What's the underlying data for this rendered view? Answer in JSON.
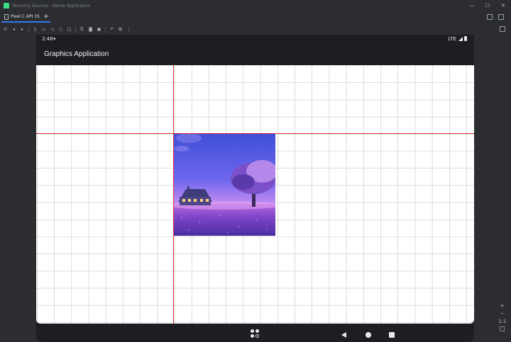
{
  "window": {
    "title": "Running Devices - Demo Application",
    "controls": [
      "—",
      "☐",
      "✕"
    ]
  },
  "tabs": [
    {
      "label": "Pixel C API 35",
      "close": "×"
    }
  ],
  "tab_add": "+",
  "toolbar": {
    "icons": [
      "power-icon",
      "volume-down-icon",
      "volume-up-icon",
      "rotate-left-icon",
      "rotate-right-icon",
      "back-icon",
      "home-icon",
      "overview-icon",
      "screenshot-icon",
      "camera-icon",
      "record-icon",
      "undo-icon",
      "snapshot-icon",
      "more-icon"
    ]
  },
  "device": {
    "status_bar": {
      "time": "2:48",
      "network": "LTE"
    },
    "app_bar": {
      "title": "Graphics Application"
    },
    "canvas": {
      "grid_color": "#c9c9c9",
      "guide_color": "#e0303a"
    }
  },
  "zoom_controls": [
    "+",
    "−",
    "1:1"
  ],
  "colors": {
    "ide_background": "#2b2d30",
    "tab_accent": "#3574f0",
    "device_chrome": "#1d1e22",
    "canvas_background": "#ffffff"
  }
}
